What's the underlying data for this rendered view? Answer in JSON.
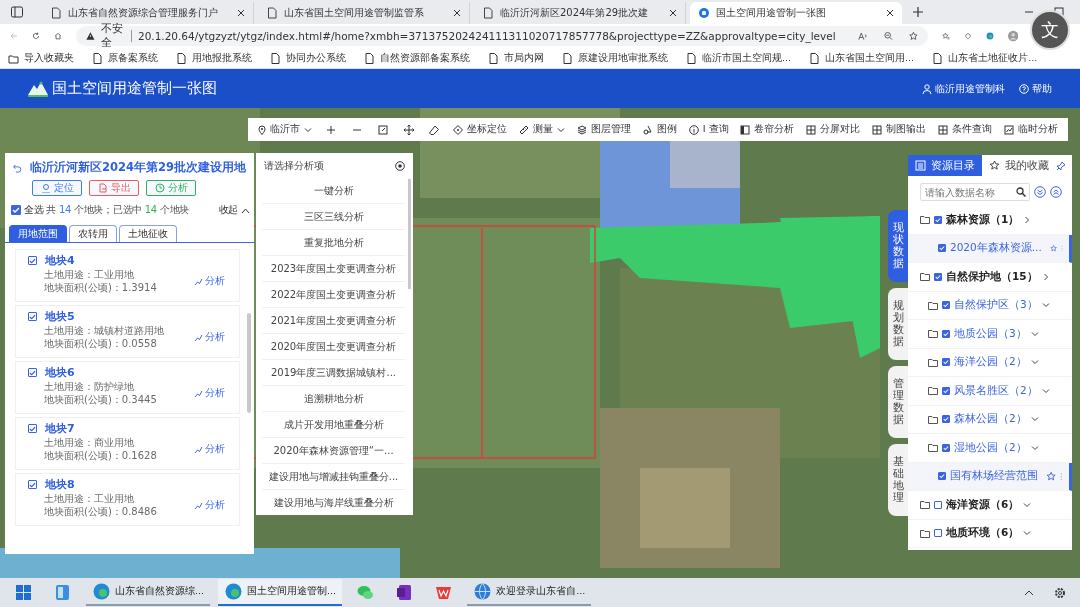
{
  "browser": {
    "tabs": [
      {
        "title": "山东省自然资源综合管理服务门户",
        "selected": false
      },
      {
        "title": "山东省国土空间用途管制监管系",
        "selected": false
      },
      {
        "title": "临沂沂河新区2024年第29批次建",
        "selected": false
      },
      {
        "title": "国土空间用途管制一张图",
        "selected": true
      }
    ],
    "security": "不安全",
    "url": "20.1.20.64/ytgzyzt/ytgz/index.html#/home?xmbh=371375202424111311020717857778&projecttype=ZZ&approvaltype=city_level",
    "translate_button": "文",
    "bookmarks": [
      {
        "label": "导入收藏夹",
        "kind": "folder"
      },
      {
        "label": "原备案系统",
        "kind": "page"
      },
      {
        "label": "用地报批系统",
        "kind": "page"
      },
      {
        "label": "协同办公系统",
        "kind": "page"
      },
      {
        "label": "自然资源部备案系统",
        "kind": "page"
      },
      {
        "label": "市局内网",
        "kind": "page"
      },
      {
        "label": "原建设用地审批系统",
        "kind": "page"
      },
      {
        "label": "临沂市国土空间规...",
        "kind": "page"
      },
      {
        "label": "山东省国土空间用...",
        "kind": "page"
      },
      {
        "label": "山东省土地征收片...",
        "kind": "page"
      }
    ]
  },
  "app": {
    "title": "国土空间用途管制一张图",
    "user": "临沂用途管制科",
    "help": "帮助"
  },
  "toolbar": [
    {
      "kind": "city",
      "label": "临沂市"
    },
    {
      "kind": "zoom-in"
    },
    {
      "kind": "zoom-out"
    },
    {
      "kind": "fullscreen"
    },
    {
      "kind": "pan"
    },
    {
      "kind": "eraser"
    },
    {
      "kind": "tool",
      "label": "坐标定位"
    },
    {
      "kind": "dropdown",
      "label": "测量"
    },
    {
      "kind": "tool",
      "label": "图层管理"
    },
    {
      "kind": "tool",
      "label": "图例"
    },
    {
      "kind": "tool",
      "label": "I 查询"
    },
    {
      "kind": "tool",
      "label": "卷帘分析"
    },
    {
      "kind": "tool",
      "label": "分屏对比"
    },
    {
      "kind": "tool",
      "label": "制图输出"
    },
    {
      "kind": "tool",
      "label": "条件查询"
    },
    {
      "kind": "tool",
      "label": "临时分析"
    }
  ],
  "left_panel": {
    "title": "临沂沂河新区2024年第29批次建设用地",
    "buttons": [
      {
        "label": "定位",
        "color": "#3b7cf0"
      },
      {
        "label": "导出",
        "color": "#ef5b5b"
      },
      {
        "label": "分析",
        "color": "#2fb35a"
      }
    ],
    "select_all": {
      "label": "全选",
      "checked": true
    },
    "summary": {
      "text_1": "共",
      "total": "14",
      "text_2": "个地块；已选中",
      "selected_count": "14",
      "text_3": "个地块"
    },
    "collapse": "收起",
    "tabs": [
      {
        "label": "用地范围",
        "selected": true
      },
      {
        "label": "农转用",
        "selected": false
      },
      {
        "label": "土地征收",
        "selected": false
      }
    ],
    "parcels": [
      {
        "name": "地块4",
        "use": "土地用途：工业用地",
        "area": "地块面积(公顷)：1.3914",
        "action": "分析",
        "checked": true
      },
      {
        "name": "地块5",
        "use": "土地用途：城镇村道路用地",
        "area": "地块面积(公顷)：0.0558",
        "action": "分析",
        "checked": true
      },
      {
        "name": "地块6",
        "use": "土地用途：防护绿地",
        "area": "地块面积(公顷)：0.3445",
        "action": "分析",
        "checked": true
      },
      {
        "name": "地块7",
        "use": "土地用途：商业用地",
        "area": "地块面积(公顷)：0.1628",
        "action": "分析",
        "checked": true
      },
      {
        "name": "地块8",
        "use": "土地用途：工业用地",
        "area": "地块面积(公顷)：0.8486",
        "action": "分析",
        "checked": true
      }
    ]
  },
  "analysis_panel": {
    "title": "请选择分析项",
    "items": [
      "一键分析",
      "三区三线分析",
      "重复批地分析",
      "2023年度国土变更调查分析",
      "2022年度国土变更调查分析",
      "2021年度国土变更调查分析",
      "2020年度国土变更调查分析",
      "2019年度三调数据城镇村...",
      "追溯耕地分析",
      "成片开发用地重叠分析",
      "2020年森林资源管理“一...",
      "建设用地与增减挂钩重叠分...",
      "建设用地与海岸线重叠分析"
    ]
  },
  "resource_panel": {
    "tabs": [
      {
        "label": "资源目录",
        "selected": true
      },
      {
        "label": "我的收藏",
        "selected": false
      }
    ],
    "search": {
      "placeholder": "请输入数据名称"
    },
    "side_tabs": [
      {
        "label": "现状数据",
        "selected": true
      },
      {
        "label": "规划数据",
        "selected": false
      },
      {
        "label": "管理数据",
        "selected": false
      },
      {
        "label": "基础地理",
        "selected": false
      }
    ],
    "tree": [
      {
        "label": "森林资源（1）",
        "checked": true,
        "kind": "folder",
        "children": [
          {
            "label": "2020年森林资源...",
            "checked": true,
            "kind": "layer"
          }
        ]
      },
      {
        "label": "自然保护地（15）",
        "checked": true,
        "children": [
          {
            "label": "自然保护区（3）",
            "checked": true,
            "kind": "folder"
          },
          {
            "label": "地质公园（3）",
            "checked": true,
            "kind": "folder"
          },
          {
            "label": "海洋公园（2）",
            "checked": true,
            "kind": "folder"
          },
          {
            "label": "风景名胜区（2）",
            "checked": true,
            "kind": "folder"
          },
          {
            "label": "森林公园（2）",
            "checked": true,
            "kind": "folder"
          },
          {
            "label": "湿地公园（2）",
            "checked": true,
            "kind": "folder"
          },
          {
            "label": "国有林场经营范围",
            "checked": true,
            "kind": "layer"
          }
        ],
        "kind": "folder"
      },
      {
        "label": "海洋资源（6）",
        "checked": false,
        "kind": "folder"
      },
      {
        "label": "地质环境（6）",
        "checked": false,
        "kind": "folder"
      }
    ]
  },
  "taskbar": [
    {
      "kind": "start"
    },
    {
      "kind": "files"
    },
    {
      "kind": "browser",
      "label": "山东省自然资源综...",
      "selected": false
    },
    {
      "kind": "browser",
      "label": "国土空间用途管制...",
      "selected": true
    },
    {
      "kind": "chat"
    },
    {
      "kind": "notes"
    },
    {
      "kind": "office"
    },
    {
      "kind": "globe",
      "label": "欢迎登录山东省自...",
      "selected": false
    }
  ]
}
